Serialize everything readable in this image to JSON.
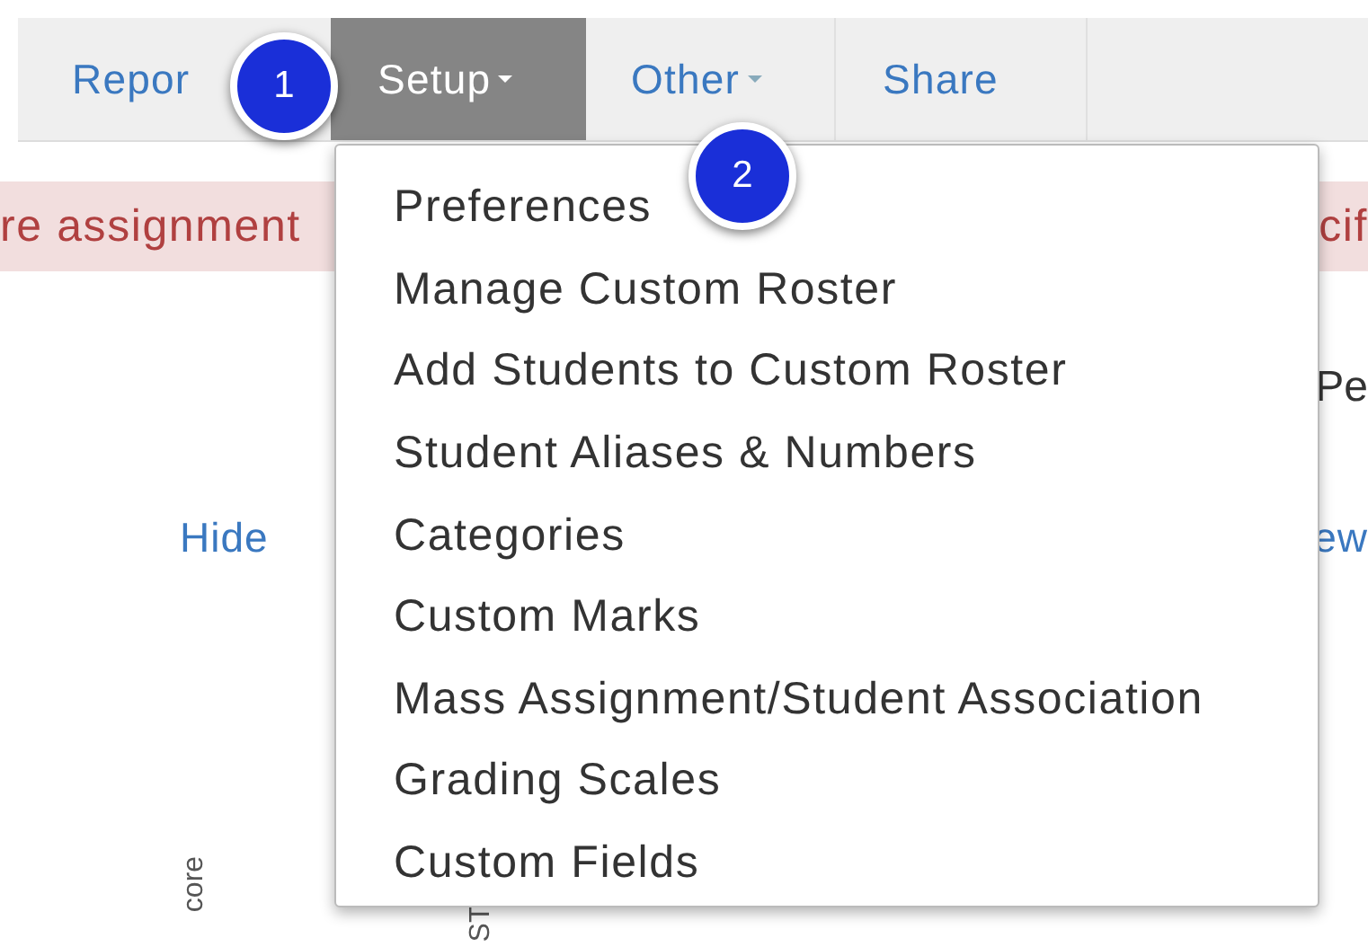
{
  "nav": {
    "tabs": [
      {
        "label": "Repor",
        "selected": false,
        "dropdown": false
      },
      {
        "label": "Setup",
        "selected": true,
        "dropdown": true
      },
      {
        "label": "Other",
        "selected": false,
        "dropdown": true
      },
      {
        "label": "Share",
        "selected": false,
        "dropdown": false
      }
    ]
  },
  "alert": {
    "left": "re assignment",
    "right": "cif"
  },
  "side_texts": {
    "right_1": "Pe",
    "left_link": "Hide",
    "right_link": "ew"
  },
  "column_headers": [
    "core",
    "ST"
  ],
  "menu": {
    "items": [
      "Preferences",
      "Manage Custom Roster",
      "Add Students to Custom Roster",
      "Student Aliases & Numbers",
      "Categories",
      "Custom Marks",
      "Mass Assignment/Student Association",
      "Grading Scales",
      "Custom Fields"
    ]
  },
  "callouts": [
    "1",
    "2"
  ]
}
